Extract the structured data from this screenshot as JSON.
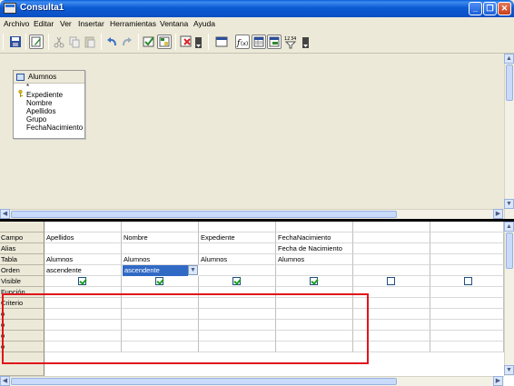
{
  "window": {
    "title": "Consulta1",
    "controls": {
      "minimize": "_",
      "maximize": "❐",
      "close": "✕"
    }
  },
  "menubar": {
    "items": [
      "Archivo",
      "Editar",
      "Ver",
      "Insertar",
      "Herramientas",
      "Ventana",
      "Ayuda"
    ]
  },
  "toolbar": {
    "buttons": [
      "save-icon",
      "edit-mode-icon",
      "cut-icon",
      "copy-icon",
      "paste-icon",
      "undo-icon",
      "redo-icon",
      "run-query-icon",
      "clear-query-icon",
      "delete-table-icon",
      "add-table-icon",
      "functions-icon",
      "table-name-icon",
      "alias-icon",
      "distinct-values-icon"
    ],
    "functions_label": "f(x)"
  },
  "table_window": {
    "title": "Alumnos",
    "fields": [
      "*",
      "Expediente",
      "Nombre",
      "Apellidos",
      "Grupo",
      "FechaNacimiento"
    ],
    "primary_key": "Expediente"
  },
  "grid": {
    "row_labels": [
      "Campo",
      "Alias",
      "Tabla",
      "Orden",
      "Visible",
      "Función",
      "Criterio",
      "o",
      "o",
      "o",
      "o"
    ],
    "columns": [
      {
        "campo": "Apellidos",
        "alias": "",
        "tabla": "Alumnos",
        "orden": "ascendente",
        "visible": true
      },
      {
        "campo": "Nombre",
        "alias": "",
        "tabla": "Alumnos",
        "orden": "ascendente",
        "visible": true,
        "orden_editing": true
      },
      {
        "campo": "Expediente",
        "alias": "",
        "tabla": "Alumnos",
        "orden": "",
        "visible": true
      },
      {
        "campo": "FechaNacimiento",
        "alias": "Fecha de Nacimiento",
        "tabla": "Alumnos",
        "orden": "",
        "visible": true
      },
      {
        "campo": "",
        "alias": "",
        "tabla": "",
        "orden": "",
        "visible": false
      },
      {
        "campo": "",
        "alias": "",
        "tabla": "",
        "orden": "",
        "visible": false
      }
    ]
  },
  "colors": {
    "titlebar": "#0a5fd6",
    "selection": "#316ac5",
    "highlight_box": "#e0141b",
    "checkmark": "#21a121"
  }
}
